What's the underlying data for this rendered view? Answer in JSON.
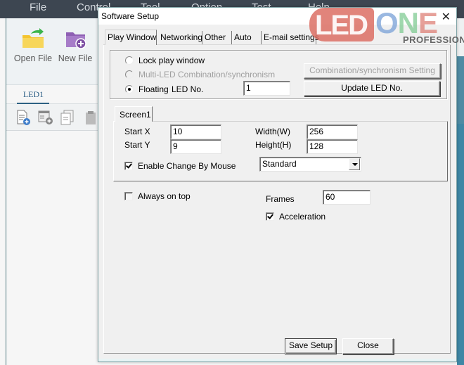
{
  "app": {
    "menu": [
      "File",
      "Control",
      "Tool",
      "Option",
      "Test",
      "Help"
    ],
    "toolbar": {
      "open_file": "Open File",
      "new_file": "New File"
    },
    "led_tab": "LED1"
  },
  "watermark": {
    "led": "LED",
    "one": [
      "O",
      "N",
      "E"
    ],
    "subtitle": "PROFESSION"
  },
  "dialog": {
    "title": "Software Setup",
    "close_glyph": "✕",
    "tabs": [
      "Play Window",
      "Networking",
      "Other",
      "Auto",
      "E-mail settings"
    ],
    "active_tab": "Play Window",
    "play_window": {
      "lock_play_window": "Lock play window",
      "multi_led": "Multi-LED Combination/synchronism",
      "floating": "Floating",
      "selected_mode": "Floating",
      "led_no_label": "LED No.",
      "led_no_value": "1",
      "combination_button": "Combination/synchronism Setting",
      "update_led_button": "Update LED No."
    },
    "screen": {
      "tab": "Screen1",
      "start_x_label": "Start X",
      "start_x": "10",
      "start_y_label": "Start Y",
      "start_y": "9",
      "width_label": "Width(W)",
      "width": "256",
      "height_label": "Height(H)",
      "height": "128",
      "enable_change_by_mouse": "Enable Change By Mouse",
      "enable_change_by_mouse_checked": true,
      "mode_selected": "Standard"
    },
    "always_on_top": "Always on top",
    "always_on_top_checked": false,
    "frames_label": "Frames",
    "frames": "60",
    "acceleration": "Acceleration",
    "acceleration_checked": true,
    "save_button": "Save Setup",
    "close_button": "Close"
  }
}
